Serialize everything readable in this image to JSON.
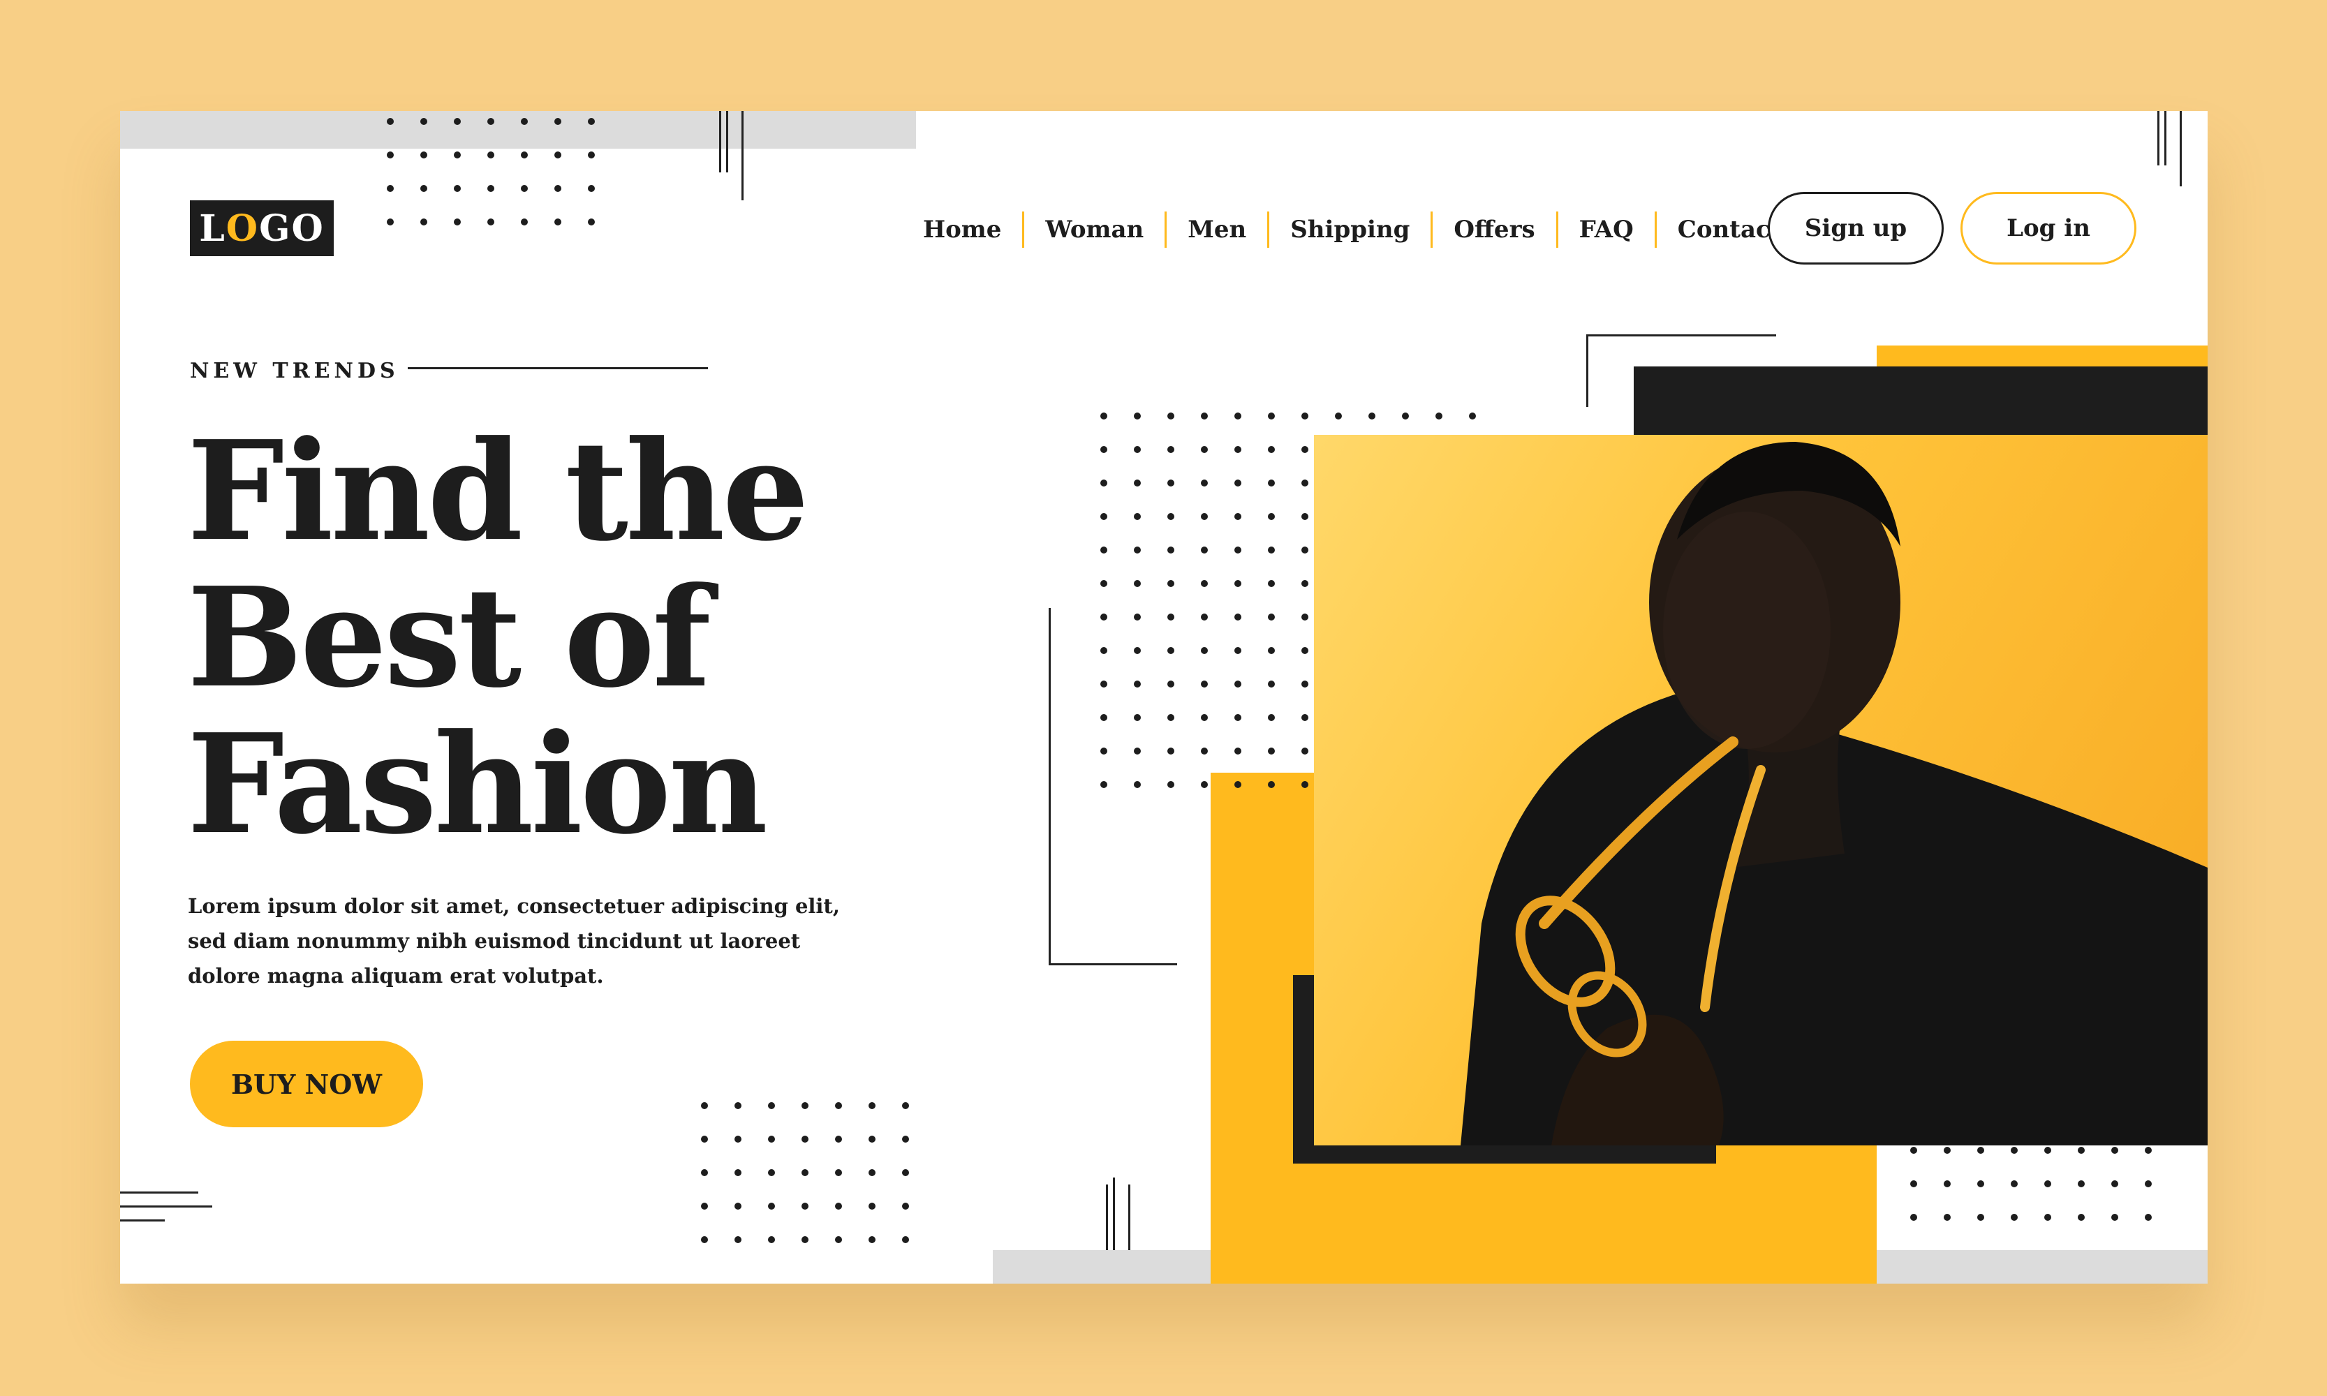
{
  "logo": {
    "text_pre": "L",
    "text_o": "O",
    "text_post": "GO"
  },
  "nav": {
    "items": [
      "Home",
      "Woman",
      "Men",
      "Shipping",
      "Offers",
      "FAQ",
      "Contact"
    ]
  },
  "auth": {
    "signup_label": "Sign up",
    "login_label": "Log in"
  },
  "hero": {
    "eyebrow": "NEW TRENDS",
    "headline_line1": "Find the",
    "headline_line2": "Best of",
    "headline_line3": "Fashion",
    "body_line1": "Lorem ipsum dolor sit amet, consectetuer adipiscing elit,",
    "body_line2": "sed diam nonummy nibh euismod tincidunt ut laoreet",
    "body_line3": "dolore magna aliquam erat volutpat.",
    "cta_label": "BUY NOW"
  },
  "colors": {
    "accent": "#ffba1e",
    "dark": "#1d1d1d",
    "background": "#f8cf86",
    "grey": "#dcdcdc"
  },
  "image": {
    "subject": "man holding yellow sunglasses on yellow background"
  }
}
